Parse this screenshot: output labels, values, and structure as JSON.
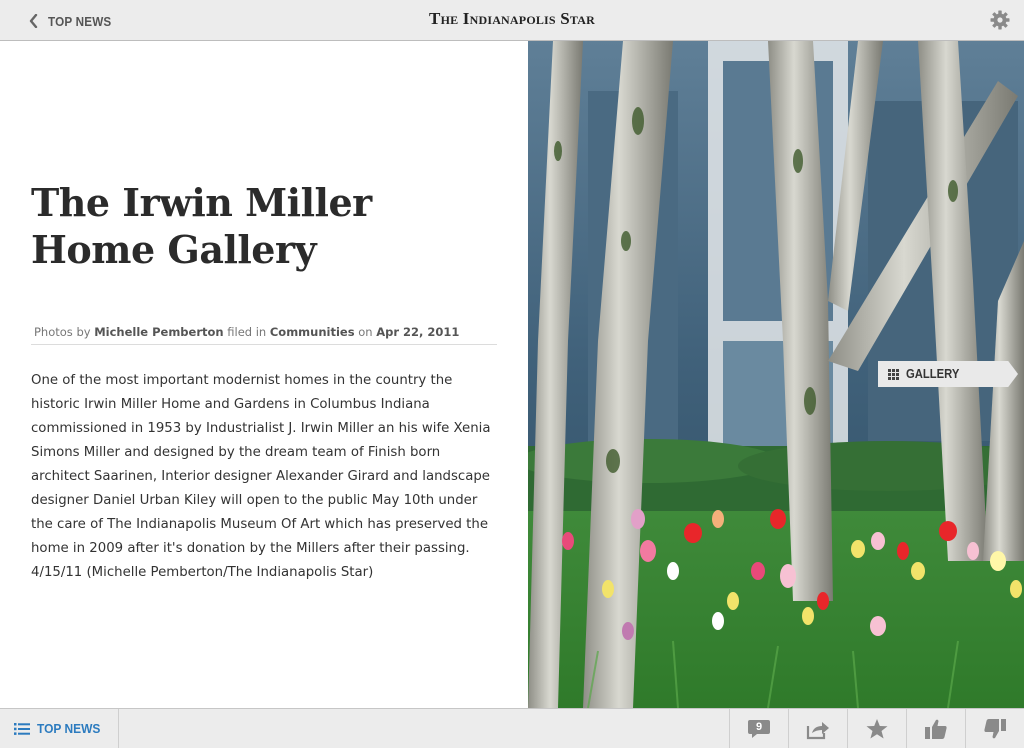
{
  "topbar": {
    "back_label": "TOP NEWS",
    "masthead": "The Indianapolis Star"
  },
  "article": {
    "title": "The Irwin Miller Home Gallery",
    "byline": {
      "prefix": "Photos by",
      "author": "Michelle Pemberton",
      "filed_in": "filed in",
      "section": "Communities",
      "on": "on",
      "date": "Apr 22, 2011"
    },
    "body": "One of the most important modernist homes in the country the historic Irwin Miller Home and Gardens in Columbus Indiana commissioned in 1953 by Industrialist J. Irwin Miller an his wife Xenia Simons Miller and designed by the dream team of Finish born architect Saarinen, Interior designer Alexander Girard and landscape designer Daniel Urban Kiley will open to the public May 10th under the care of The Indianapolis Museum Of Art which has preserved the home in 2009 after it's donation by the Millers after their passing. 4/15/11 (Michelle Pemberton/The Indianapolis Star)"
  },
  "photo": {
    "gallery_label": "GALLERY"
  },
  "bottombar": {
    "section_label": "TOP NEWS",
    "comment_count": "9",
    "actions": [
      "comments-icon",
      "share-icon",
      "star-icon",
      "thumbs-up-icon",
      "thumbs-down-icon"
    ]
  },
  "colors": {
    "link_blue": "#2c7bbf",
    "bar_gray": "#ececec"
  }
}
